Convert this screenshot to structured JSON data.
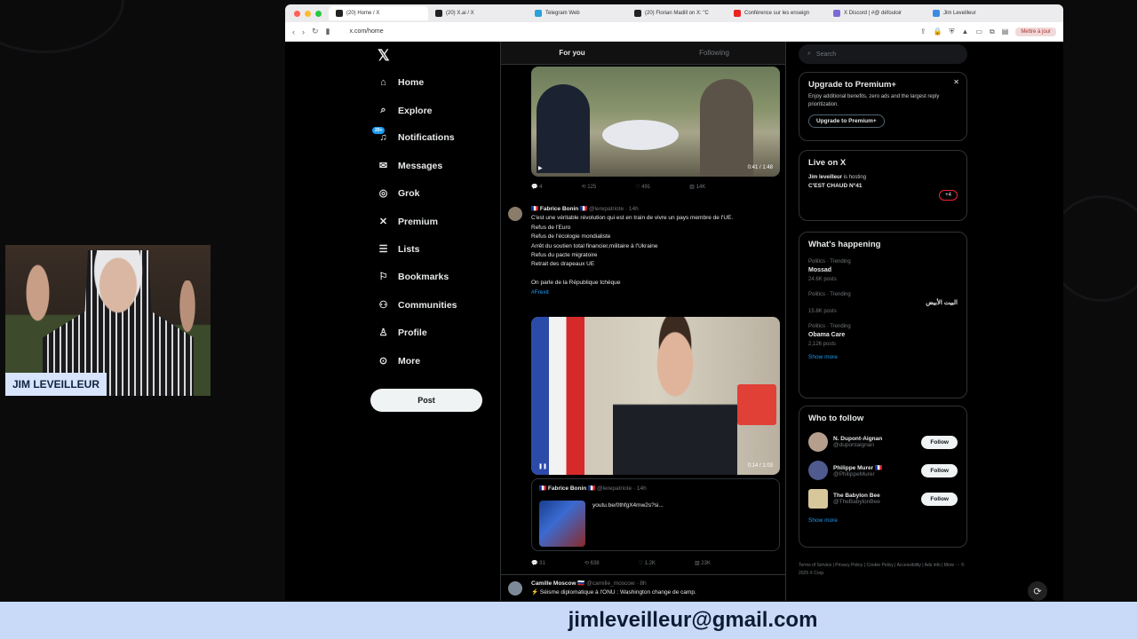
{
  "camera": {
    "label": "JIM LEVEILLEUR"
  },
  "browser": {
    "tabs": [
      {
        "label": "(20) Home / X",
        "active": true
      },
      {
        "label": "(20) X.ai / X"
      },
      {
        "label": "Telegram Web"
      },
      {
        "label": "(20) Florian Madill on X: \"C"
      },
      {
        "label": "Conférence sur les enseign"
      },
      {
        "label": "X Discord | #@ défouloir"
      },
      {
        "label": "Jim Leveilleur"
      }
    ],
    "url": "x.com/home",
    "reopen_label": "Mettre à jour"
  },
  "x": {
    "nav": [
      {
        "label": "Home",
        "icon": "⌂"
      },
      {
        "label": "Explore",
        "icon": "⌕"
      },
      {
        "label": "Notifications",
        "icon": "🔔"
      },
      {
        "label": "Messages",
        "icon": "✉"
      },
      {
        "label": "Grok",
        "icon": "◎"
      },
      {
        "label": "Premium",
        "icon": "𝕏"
      },
      {
        "label": "Lists",
        "icon": "☰"
      },
      {
        "label": "Bookmarks",
        "icon": "⚐"
      },
      {
        "label": "Communities",
        "icon": "⚇"
      },
      {
        "label": "Profile",
        "icon": "♙"
      },
      {
        "label": "More",
        "icon": "⋯"
      }
    ],
    "notif_badge": "20+",
    "post_label": "Post",
    "feed_tabs": [
      "For you",
      "Following"
    ],
    "video1": {
      "time": "0:41 / 1:48"
    },
    "tweet1_actions": [
      "4",
      "125",
      "491",
      "14K"
    ],
    "tweet2": {
      "name": "🇫🇷 Fabrice Bonin 🇫🇷",
      "handle": "@lerepatriote · 14h",
      "text": "C'est une véritable révolution qui est en train de vivre un pays membre de l'UE.\nRefus de l'Euro\nRefus de l'écologie mondialiste\nArrêt du soutien total financier,militaire à l'Ukraine\nRefus du pacte migratoire\nRetrait des drapeaux UE\n\nOn parle de la République tchèque",
      "hashtag": "#Frexit",
      "video_time": "0:14 / 1:03",
      "quote_name": "🇫🇷 Fabrice Bonin 🇫🇷",
      "quote_handle": "@lerepatriote · 14h",
      "quote_text": "youtu.be/0thfgX4mw2s?si...",
      "actions": [
        "31",
        "638",
        "1.2K",
        "23K"
      ]
    },
    "tweet3": {
      "name": "Camille Moscow 🇷🇺",
      "handle": "@camille_moscow · 8h",
      "text": "⚡ Séisme diplomatique à l'ONU : Washington change de camp."
    },
    "search_placeholder": "Search",
    "premium": {
      "title": "Upgrade to Premium+",
      "text": "Enjoy additional benefits, zero ads and the largest reply prioritization.",
      "button": "Upgrade to Premium+"
    },
    "live": {
      "title": "Live on X",
      "host": "Jim leveilleur",
      "host_status": "is hosting",
      "space": "C'EST CHAUD N°41",
      "badge": "+4"
    },
    "happening": {
      "title": "What's happening",
      "trends": [
        {
          "meta": "Politics · Trending",
          "name": "Mossad",
          "count": "24.6K posts"
        },
        {
          "meta": "Politics · Trending",
          "name": "البيت الأبيض",
          "count": "15.8K posts"
        },
        {
          "meta": "Politics · Trending",
          "name": "Obama Care",
          "count": "2,126 posts"
        }
      ],
      "show_more": "Show more"
    },
    "follow": {
      "title": "Who to follow",
      "people": [
        {
          "name": "N. Dupont-Aignan",
          "handle": "@dupontaignan",
          "button": "Follow"
        },
        {
          "name": "Philippe Murer 🇫🇷",
          "handle": "@PhilippeMurer",
          "button": "Follow"
        },
        {
          "name": "The Babylon Bee",
          "handle": "@TheBabylonBee",
          "button": "Follow"
        }
      ],
      "show_more": "Show more"
    },
    "footer": "Terms of Service | Privacy Policy | Cookie Policy | Accessibility | Ads info | More ··· © 2025 X Corp."
  },
  "bottom_bar": {
    "email": "jimleveilleur@gmail.com"
  },
  "colors": {
    "accent": "#1d9bf0",
    "bottom_bar_bg": "#c9daf8",
    "label_bg": "#d7e4fb"
  }
}
